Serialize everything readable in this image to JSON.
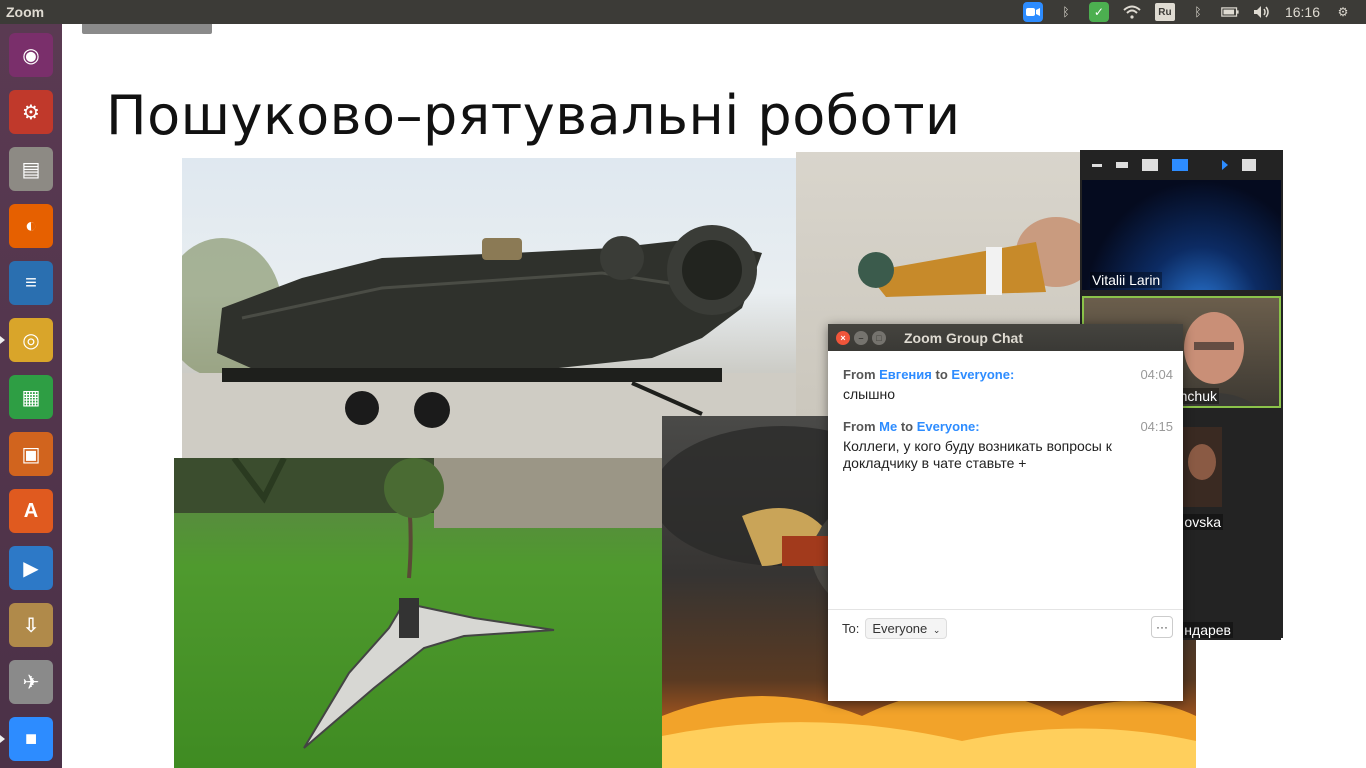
{
  "window": {
    "app_title": "Zoom"
  },
  "tray": {
    "language": "Ru",
    "clock": "16:16"
  },
  "launcher": {
    "items": [
      {
        "name": "ubuntu-dash-icon",
        "color": "#7a2f6b",
        "glyph": "◉"
      },
      {
        "name": "system-settings-icon",
        "color": "#c0392b",
        "glyph": "⚙"
      },
      {
        "name": "files-icon",
        "color": "#8d8a84",
        "glyph": "▤"
      },
      {
        "name": "firefox-icon",
        "color": "#e66000",
        "glyph": "◐"
      },
      {
        "name": "writer-icon",
        "color": "#2a6fb0",
        "glyph": "≡"
      },
      {
        "name": "chrome-icon",
        "color": "#d9a52a",
        "glyph": "◎"
      },
      {
        "name": "calc-icon",
        "color": "#2e9e44",
        "glyph": "▦"
      },
      {
        "name": "impress-icon",
        "color": "#d1641e",
        "glyph": "▣"
      },
      {
        "name": "software-center-icon",
        "color": "#e05a1f",
        "glyph": "A"
      },
      {
        "name": "media-player-icon",
        "color": "#2d79c7",
        "glyph": "▶"
      },
      {
        "name": "archive-manager-icon",
        "color": "#b08a4a",
        "glyph": "⇩"
      },
      {
        "name": "tool-icon",
        "color": "#8a8a8a",
        "glyph": "✈"
      },
      {
        "name": "zoom-launcher-icon",
        "color": "#2d8cff",
        "glyph": "■"
      }
    ]
  },
  "slide": {
    "title": "Пошуково–рятувальні  роботи"
  },
  "gallery": {
    "participants": [
      {
        "name": "Vitalii Larin"
      },
      {
        "name": "hchuk"
      },
      {
        "name": "ovska"
      },
      {
        "name": "ндарев"
      }
    ]
  },
  "chat": {
    "title": "Zoom Group Chat",
    "from_label": "From",
    "to_label_word": "to",
    "messages": [
      {
        "from": "Евгения",
        "to": "Everyone:",
        "time": "04:04",
        "text": "слышно"
      },
      {
        "from": "Me",
        "to": "Everyone:",
        "time": "04:15",
        "text": "Коллеги, у кого буду возникать вопросы к докладчику в чате ставьте +"
      }
    ],
    "to_prefix": "To:",
    "to_value": "Everyone",
    "more": "···"
  },
  "colors": {
    "accent": "#2d8cff",
    "launcher": "#5a3a52",
    "panel": "#3c3b37",
    "active_speaker": "#8bc34a"
  }
}
